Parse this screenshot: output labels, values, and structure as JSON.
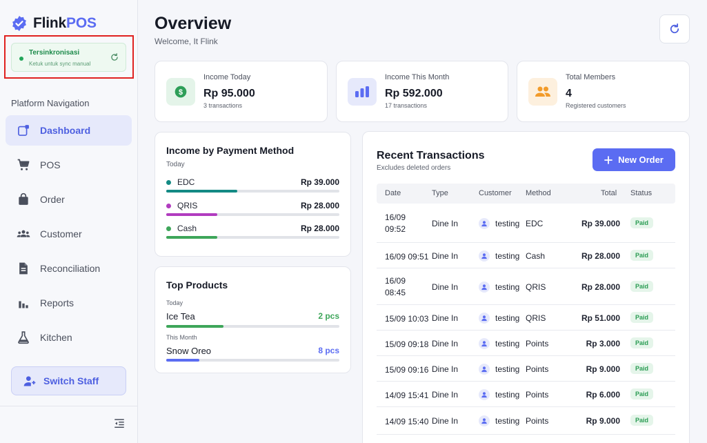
{
  "app": {
    "brand_main": "Flink",
    "brand_accent": "POS"
  },
  "sync": {
    "title": "Tersinkronisasi",
    "subtitle": "Ketuk untuk sync manual"
  },
  "nav": {
    "heading": "Platform Navigation",
    "items": [
      {
        "label": "Dashboard",
        "icon": "dashboard-icon",
        "active": true
      },
      {
        "label": "POS",
        "icon": "cart-icon"
      },
      {
        "label": "Order",
        "icon": "bag-icon"
      },
      {
        "label": "Customer",
        "icon": "group-icon"
      },
      {
        "label": "Reconciliation",
        "icon": "document-icon"
      },
      {
        "label": "Reports",
        "icon": "bar-chart-icon"
      },
      {
        "label": "Kitchen",
        "icon": "flask-icon"
      }
    ],
    "switch_staff": "Switch Staff"
  },
  "header": {
    "title": "Overview",
    "subtitle": "Welcome, It Flink"
  },
  "stats": [
    {
      "label": "Income Today",
      "value": "Rp 95.000",
      "sub": "3 transactions",
      "icon": "dollar-icon",
      "color": "#2e9e58"
    },
    {
      "label": "Income This Month",
      "value": "Rp 592.000",
      "sub": "17 transactions",
      "icon": "bar-chart-icon",
      "color": "#5b6cf2"
    },
    {
      "label": "Total Members",
      "value": "4",
      "sub": "Registered customers",
      "icon": "group-icon",
      "color": "#f29b2a"
    }
  ],
  "payment": {
    "title": "Income by Payment Method",
    "period": "Today",
    "methods": [
      {
        "name": "EDC",
        "amount": "Rp 39.000",
        "fraction": 0.41,
        "color": "#138a84"
      },
      {
        "name": "QRIS",
        "amount": "Rp 28.000",
        "fraction": 0.295,
        "color": "#b13cbf"
      },
      {
        "name": "Cash",
        "amount": "Rp 28.000",
        "fraction": 0.295,
        "color": "#3ea65a"
      }
    ]
  },
  "top_products": {
    "title": "Top Products",
    "items": [
      {
        "period": "Today",
        "name": "Ice Tea",
        "qty": "2 pcs",
        "fraction": 0.33,
        "color": "#3ea65a"
      },
      {
        "period": "This Month",
        "name": "Snow Oreo",
        "qty": "8 pcs",
        "fraction": 0.19,
        "color": "#5b6cf2"
      }
    ]
  },
  "transactions": {
    "title": "Recent Transactions",
    "subtitle": "Excludes deleted orders",
    "new_order": "New Order",
    "columns": [
      "Date",
      "Type",
      "Customer",
      "Method",
      "Total",
      "Status"
    ],
    "rows": [
      {
        "date": "16/09 09:52",
        "type": "Dine In",
        "customer": "testing",
        "method": "EDC",
        "total": "Rp 39.000",
        "status": "Paid"
      },
      {
        "date": "16/09 09:51",
        "type": "Dine In",
        "customer": "testing",
        "method": "Cash",
        "total": "Rp 28.000",
        "status": "Paid"
      },
      {
        "date": "16/09 08:45",
        "type": "Dine In",
        "customer": "testing",
        "method": "QRIS",
        "total": "Rp 28.000",
        "status": "Paid"
      },
      {
        "date": "15/09 10:03",
        "type": "Dine In",
        "customer": "testing",
        "method": "QRIS",
        "total": "Rp 51.000",
        "status": "Paid"
      },
      {
        "date": "15/09 09:18",
        "type": "Dine In",
        "customer": "testing",
        "method": "Points",
        "total": "Rp 3.000",
        "status": "Paid"
      },
      {
        "date": "15/09 09:16",
        "type": "Dine In",
        "customer": "testing",
        "method": "Points",
        "total": "Rp 9.000",
        "status": "Paid"
      },
      {
        "date": "14/09 15:41",
        "type": "Dine In",
        "customer": "testing",
        "method": "Points",
        "total": "Rp 6.000",
        "status": "Paid"
      },
      {
        "date": "14/09 15:40",
        "type": "Dine In",
        "customer": "testing",
        "method": "Points",
        "total": "Rp 9.000",
        "status": "Paid"
      }
    ]
  },
  "colors": {
    "accent": "#5b6cf2",
    "success": "#2a9c53",
    "highlight_box": "#e0201f"
  }
}
